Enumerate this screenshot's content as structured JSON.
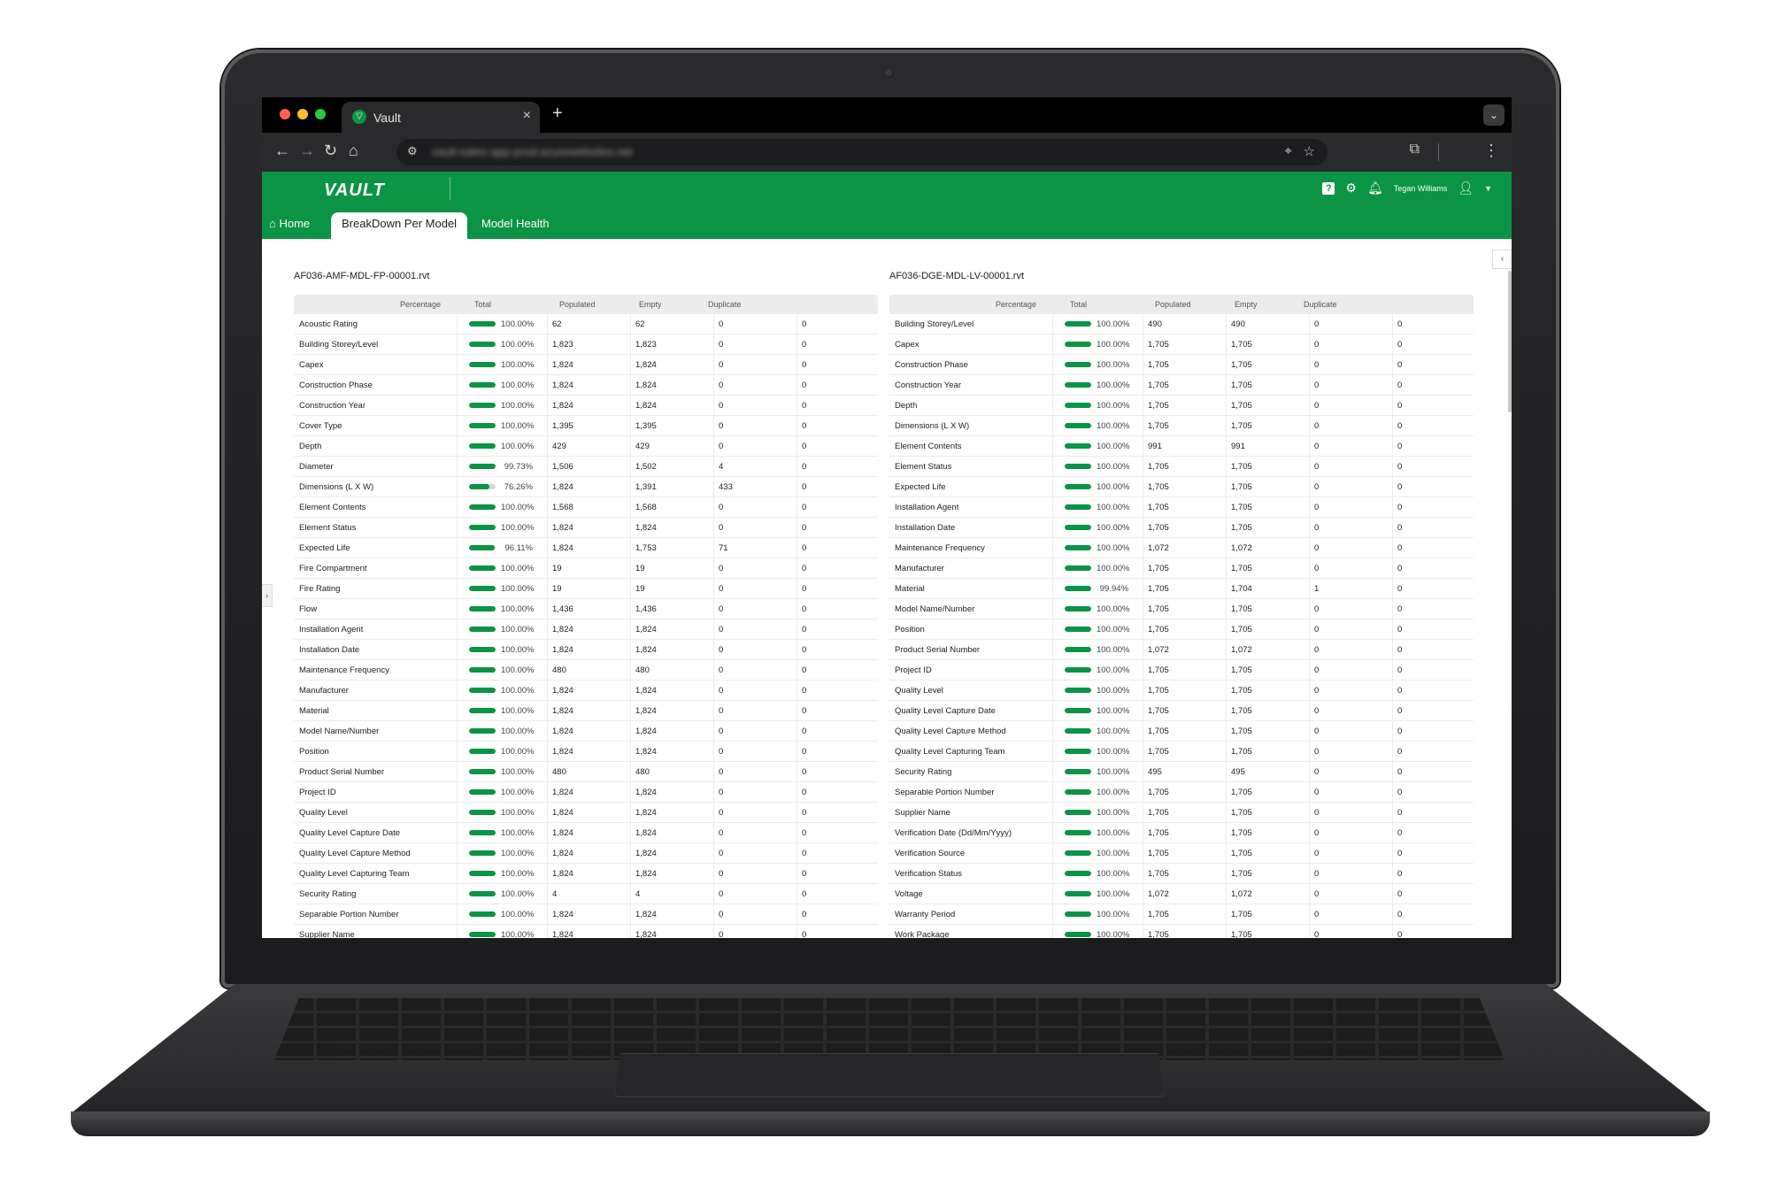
{
  "browser": {
    "tab_title": "Vault",
    "url": "vault-sales-app-prod.azurewebsites.net"
  },
  "app": {
    "logo": "VAULT",
    "user_name": "Tegan Williams",
    "nav": {
      "home": "Home",
      "breakdown": "BreakDown Per Model",
      "health": "Model Health"
    }
  },
  "colors": {
    "brand_green": "#0b9444",
    "bar_track": "#d9d9d9"
  },
  "headers": [
    "Percentage",
    "Total",
    "Populated",
    "Empty",
    "Duplicate"
  ],
  "models": [
    {
      "title": "AF036-AMF-MDL-FP-00001.rvt",
      "rows": [
        {
          "label": "Acoustic Rating",
          "pct": "100.00%",
          "fill": 1.0,
          "total": "62",
          "populated": "62",
          "empty": "0",
          "duplicate": "0"
        },
        {
          "label": "Building Storey/Level",
          "pct": "100.00%",
          "fill": 1.0,
          "total": "1,823",
          "populated": "1,823",
          "empty": "0",
          "duplicate": "0"
        },
        {
          "label": "Capex",
          "pct": "100.00%",
          "fill": 1.0,
          "total": "1,824",
          "populated": "1,824",
          "empty": "0",
          "duplicate": "0"
        },
        {
          "label": "Construction Phase",
          "pct": "100.00%",
          "fill": 1.0,
          "total": "1,824",
          "populated": "1,824",
          "empty": "0",
          "duplicate": "0"
        },
        {
          "label": "Construction Year",
          "pct": "100.00%",
          "fill": 1.0,
          "total": "1,824",
          "populated": "1,824",
          "empty": "0",
          "duplicate": "0"
        },
        {
          "label": "Cover Type",
          "pct": "100.00%",
          "fill": 1.0,
          "total": "1,395",
          "populated": "1,395",
          "empty": "0",
          "duplicate": "0"
        },
        {
          "label": "Depth",
          "pct": "100.00%",
          "fill": 1.0,
          "total": "429",
          "populated": "429",
          "empty": "0",
          "duplicate": "0"
        },
        {
          "label": "Diameter",
          "pct": "99.73%",
          "fill": 0.9973,
          "total": "1,506",
          "populated": "1,502",
          "empty": "4",
          "duplicate": "0"
        },
        {
          "label": "Dimensions (L X W)",
          "pct": "76.26%",
          "fill": 0.7626,
          "total": "1,824",
          "populated": "1,391",
          "empty": "433",
          "duplicate": "0"
        },
        {
          "label": "Element Contents",
          "pct": "100.00%",
          "fill": 1.0,
          "total": "1,568",
          "populated": "1,568",
          "empty": "0",
          "duplicate": "0"
        },
        {
          "label": "Element Status",
          "pct": "100.00%",
          "fill": 1.0,
          "total": "1,824",
          "populated": "1,824",
          "empty": "0",
          "duplicate": "0"
        },
        {
          "label": "Expected Life",
          "pct": "96.11%",
          "fill": 0.9611,
          "total": "1,824",
          "populated": "1,753",
          "empty": "71",
          "duplicate": "0"
        },
        {
          "label": "Fire Compartment",
          "pct": "100.00%",
          "fill": 1.0,
          "total": "19",
          "populated": "19",
          "empty": "0",
          "duplicate": "0"
        },
        {
          "label": "Fire Rating",
          "pct": "100.00%",
          "fill": 1.0,
          "total": "19",
          "populated": "19",
          "empty": "0",
          "duplicate": "0"
        },
        {
          "label": "Flow",
          "pct": "100.00%",
          "fill": 1.0,
          "total": "1,436",
          "populated": "1,436",
          "empty": "0",
          "duplicate": "0"
        },
        {
          "label": "Installation Agent",
          "pct": "100.00%",
          "fill": 1.0,
          "total": "1,824",
          "populated": "1,824",
          "empty": "0",
          "duplicate": "0"
        },
        {
          "label": "Installation Date",
          "pct": "100.00%",
          "fill": 1.0,
          "total": "1,824",
          "populated": "1,824",
          "empty": "0",
          "duplicate": "0"
        },
        {
          "label": "Maintenance Frequency",
          "pct": "100.00%",
          "fill": 1.0,
          "total": "480",
          "populated": "480",
          "empty": "0",
          "duplicate": "0"
        },
        {
          "label": "Manufacturer",
          "pct": "100.00%",
          "fill": 1.0,
          "total": "1,824",
          "populated": "1,824",
          "empty": "0",
          "duplicate": "0"
        },
        {
          "label": "Material",
          "pct": "100.00%",
          "fill": 1.0,
          "total": "1,824",
          "populated": "1,824",
          "empty": "0",
          "duplicate": "0"
        },
        {
          "label": "Model Name/Number",
          "pct": "100.00%",
          "fill": 1.0,
          "total": "1,824",
          "populated": "1,824",
          "empty": "0",
          "duplicate": "0"
        },
        {
          "label": "Position",
          "pct": "100.00%",
          "fill": 1.0,
          "total": "1,824",
          "populated": "1,824",
          "empty": "0",
          "duplicate": "0"
        },
        {
          "label": "Product Serial Number",
          "pct": "100.00%",
          "fill": 1.0,
          "total": "480",
          "populated": "480",
          "empty": "0",
          "duplicate": "0"
        },
        {
          "label": "Project ID",
          "pct": "100.00%",
          "fill": 1.0,
          "total": "1,824",
          "populated": "1,824",
          "empty": "0",
          "duplicate": "0"
        },
        {
          "label": "Quality Level",
          "pct": "100.00%",
          "fill": 1.0,
          "total": "1,824",
          "populated": "1,824",
          "empty": "0",
          "duplicate": "0"
        },
        {
          "label": "Quality Level Capture Date",
          "pct": "100.00%",
          "fill": 1.0,
          "total": "1,824",
          "populated": "1,824",
          "empty": "0",
          "duplicate": "0"
        },
        {
          "label": "Quality Level Capture Method",
          "pct": "100.00%",
          "fill": 1.0,
          "total": "1,824",
          "populated": "1,824",
          "empty": "0",
          "duplicate": "0"
        },
        {
          "label": "Quality Level Capturing Team",
          "pct": "100.00%",
          "fill": 1.0,
          "total": "1,824",
          "populated": "1,824",
          "empty": "0",
          "duplicate": "0"
        },
        {
          "label": "Security Rating",
          "pct": "100.00%",
          "fill": 1.0,
          "total": "4",
          "populated": "4",
          "empty": "0",
          "duplicate": "0"
        },
        {
          "label": "Separable Portion Number",
          "pct": "100.00%",
          "fill": 1.0,
          "total": "1,824",
          "populated": "1,824",
          "empty": "0",
          "duplicate": "0"
        },
        {
          "label": "Supplier Name",
          "pct": "100.00%",
          "fill": 1.0,
          "total": "1,824",
          "populated": "1,824",
          "empty": "0",
          "duplicate": "0"
        }
      ]
    },
    {
      "title": "AF036-DGE-MDL-LV-00001.rvt",
      "rows": [
        {
          "label": "Building Storey/Level",
          "pct": "100.00%",
          "fill": 1.0,
          "total": "490",
          "populated": "490",
          "empty": "0",
          "duplicate": "0"
        },
        {
          "label": "Capex",
          "pct": "100.00%",
          "fill": 1.0,
          "total": "1,705",
          "populated": "1,705",
          "empty": "0",
          "duplicate": "0"
        },
        {
          "label": "Construction Phase",
          "pct": "100.00%",
          "fill": 1.0,
          "total": "1,705",
          "populated": "1,705",
          "empty": "0",
          "duplicate": "0"
        },
        {
          "label": "Construction Year",
          "pct": "100.00%",
          "fill": 1.0,
          "total": "1,705",
          "populated": "1,705",
          "empty": "0",
          "duplicate": "0"
        },
        {
          "label": "Depth",
          "pct": "100.00%",
          "fill": 1.0,
          "total": "1,705",
          "populated": "1,705",
          "empty": "0",
          "duplicate": "0"
        },
        {
          "label": "Dimensions (L X W)",
          "pct": "100.00%",
          "fill": 1.0,
          "total": "1,705",
          "populated": "1,705",
          "empty": "0",
          "duplicate": "0"
        },
        {
          "label": "Element Contents",
          "pct": "100.00%",
          "fill": 1.0,
          "total": "991",
          "populated": "991",
          "empty": "0",
          "duplicate": "0"
        },
        {
          "label": "Element Status",
          "pct": "100.00%",
          "fill": 1.0,
          "total": "1,705",
          "populated": "1,705",
          "empty": "0",
          "duplicate": "0"
        },
        {
          "label": "Expected Life",
          "pct": "100.00%",
          "fill": 1.0,
          "total": "1,705",
          "populated": "1,705",
          "empty": "0",
          "duplicate": "0"
        },
        {
          "label": "Installation Agent",
          "pct": "100.00%",
          "fill": 1.0,
          "total": "1,705",
          "populated": "1,705",
          "empty": "0",
          "duplicate": "0"
        },
        {
          "label": "Installation Date",
          "pct": "100.00%",
          "fill": 1.0,
          "total": "1,705",
          "populated": "1,705",
          "empty": "0",
          "duplicate": "0"
        },
        {
          "label": "Maintenance Frequency",
          "pct": "100.00%",
          "fill": 1.0,
          "total": "1,072",
          "populated": "1,072",
          "empty": "0",
          "duplicate": "0"
        },
        {
          "label": "Manufacturer",
          "pct": "100.00%",
          "fill": 1.0,
          "total": "1,705",
          "populated": "1,705",
          "empty": "0",
          "duplicate": "0"
        },
        {
          "label": "Material",
          "pct": "99.94%",
          "fill": 0.9994,
          "total": "1,705",
          "populated": "1,704",
          "empty": "1",
          "duplicate": "0"
        },
        {
          "label": "Model Name/Number",
          "pct": "100.00%",
          "fill": 1.0,
          "total": "1,705",
          "populated": "1,705",
          "empty": "0",
          "duplicate": "0"
        },
        {
          "label": "Position",
          "pct": "100.00%",
          "fill": 1.0,
          "total": "1,705",
          "populated": "1,705",
          "empty": "0",
          "duplicate": "0"
        },
        {
          "label": "Product Serial Number",
          "pct": "100.00%",
          "fill": 1.0,
          "total": "1,072",
          "populated": "1,072",
          "empty": "0",
          "duplicate": "0"
        },
        {
          "label": "Project ID",
          "pct": "100.00%",
          "fill": 1.0,
          "total": "1,705",
          "populated": "1,705",
          "empty": "0",
          "duplicate": "0"
        },
        {
          "label": "Quality Level",
          "pct": "100.00%",
          "fill": 1.0,
          "total": "1,705",
          "populated": "1,705",
          "empty": "0",
          "duplicate": "0"
        },
        {
          "label": "Quality Level Capture Date",
          "pct": "100.00%",
          "fill": 1.0,
          "total": "1,705",
          "populated": "1,705",
          "empty": "0",
          "duplicate": "0"
        },
        {
          "label": "Quality Level Capture Method",
          "pct": "100.00%",
          "fill": 1.0,
          "total": "1,705",
          "populated": "1,705",
          "empty": "0",
          "duplicate": "0"
        },
        {
          "label": "Quality Level Capturing Team",
          "pct": "100.00%",
          "fill": 1.0,
          "total": "1,705",
          "populated": "1,705",
          "empty": "0",
          "duplicate": "0"
        },
        {
          "label": "Security Rating",
          "pct": "100.00%",
          "fill": 1.0,
          "total": "495",
          "populated": "495",
          "empty": "0",
          "duplicate": "0"
        },
        {
          "label": "Separable Portion Number",
          "pct": "100.00%",
          "fill": 1.0,
          "total": "1,705",
          "populated": "1,705",
          "empty": "0",
          "duplicate": "0"
        },
        {
          "label": "Supplier Name",
          "pct": "100.00%",
          "fill": 1.0,
          "total": "1,705",
          "populated": "1,705",
          "empty": "0",
          "duplicate": "0"
        },
        {
          "label": "Verification Date (Dd/Mm/Yyyy)",
          "pct": "100.00%",
          "fill": 1.0,
          "total": "1,705",
          "populated": "1,705",
          "empty": "0",
          "duplicate": "0"
        },
        {
          "label": "Verification Source",
          "pct": "100.00%",
          "fill": 1.0,
          "total": "1,705",
          "populated": "1,705",
          "empty": "0",
          "duplicate": "0"
        },
        {
          "label": "Verification Status",
          "pct": "100.00%",
          "fill": 1.0,
          "total": "1,705",
          "populated": "1,705",
          "empty": "0",
          "duplicate": "0"
        },
        {
          "label": "Voltage",
          "pct": "100.00%",
          "fill": 1.0,
          "total": "1,072",
          "populated": "1,072",
          "empty": "0",
          "duplicate": "0"
        },
        {
          "label": "Warranty Period",
          "pct": "100.00%",
          "fill": 1.0,
          "total": "1,705",
          "populated": "1,705",
          "empty": "0",
          "duplicate": "0"
        },
        {
          "label": "Work Package",
          "pct": "100.00%",
          "fill": 1.0,
          "total": "1,705",
          "populated": "1,705",
          "empty": "0",
          "duplicate": "0"
        }
      ]
    }
  ]
}
